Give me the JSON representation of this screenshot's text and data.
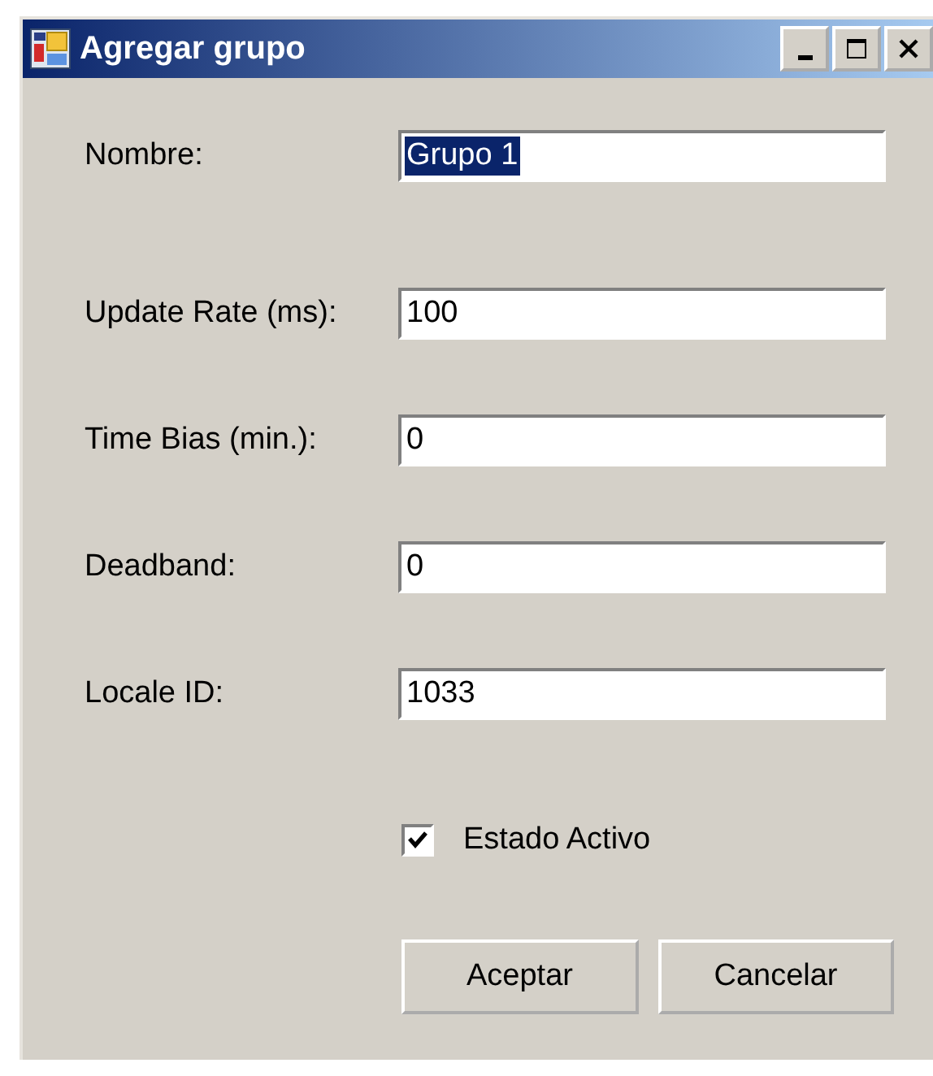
{
  "window": {
    "title": "Agregar grupo"
  },
  "fields": [
    {
      "label": "Nombre:",
      "value": "Grupo 1",
      "highlighted": true
    },
    {
      "label": "Update Rate (ms):",
      "value": "100",
      "highlighted": false
    },
    {
      "label": "Time Bias (min.):",
      "value": "0",
      "highlighted": false
    },
    {
      "label": "Deadband:",
      "value": "0",
      "highlighted": false
    },
    {
      "label": "Locale ID:",
      "value": "1033",
      "highlighted": false
    }
  ],
  "checkbox": {
    "label": "Estado Activo",
    "checked": true
  },
  "buttons": [
    "Aceptar",
    "Cancelar"
  ]
}
